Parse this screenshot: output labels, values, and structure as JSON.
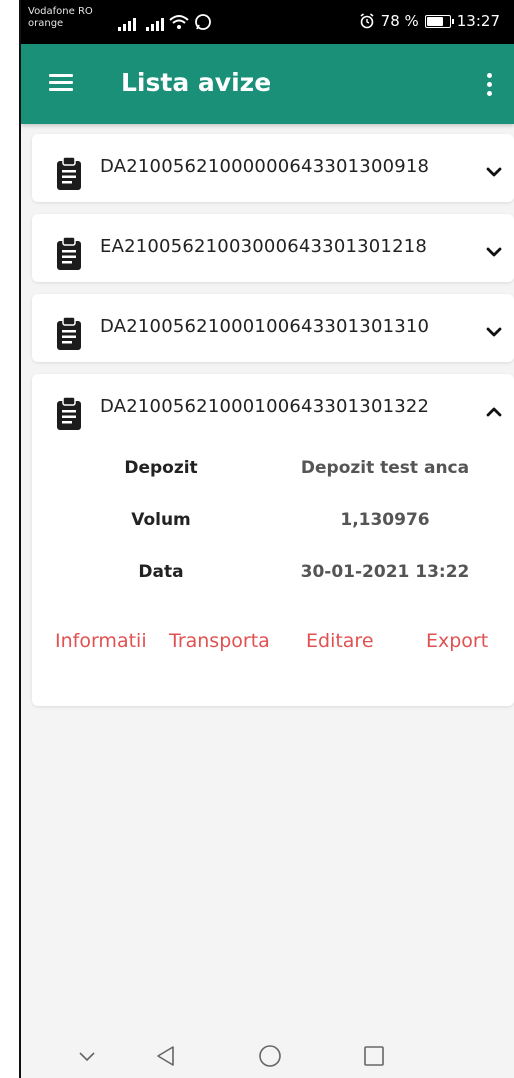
{
  "status_bar": {
    "carrier_line1": "Vodafone RO",
    "carrier_line2": "orange",
    "battery_percent": 78,
    "battery_label": "78 %",
    "time": "13:27"
  },
  "app_bar": {
    "title": "Lista avize",
    "menu_icon": "hamburger-menu-icon",
    "more_icon": "more-vert-icon"
  },
  "avize": [
    {
      "id": "DA21005621000000643301300918",
      "expanded": false
    },
    {
      "id": "EA21005621003000643301301218",
      "expanded": false
    },
    {
      "id": "DA21005621000100643301301310",
      "expanded": false
    },
    {
      "id": "DA21005621000100643301301322",
      "expanded": true,
      "details": [
        {
          "label": "Depozit",
          "value": "Depozit test anca"
        },
        {
          "label": "Volum",
          "value": "1,130976"
        },
        {
          "label": "Data",
          "value": "30-01-2021 13:22"
        }
      ],
      "actions": [
        "Informatii",
        "Transporta",
        "Editare",
        "Export"
      ]
    }
  ],
  "colors": {
    "app_bar": "#1a9079",
    "action_text": "#e05252",
    "background": "#f4f4f4"
  },
  "nav_bar": {
    "icons": [
      "chevron-down-icon",
      "back-triangle-icon",
      "home-circle-icon",
      "recents-square-icon"
    ]
  }
}
